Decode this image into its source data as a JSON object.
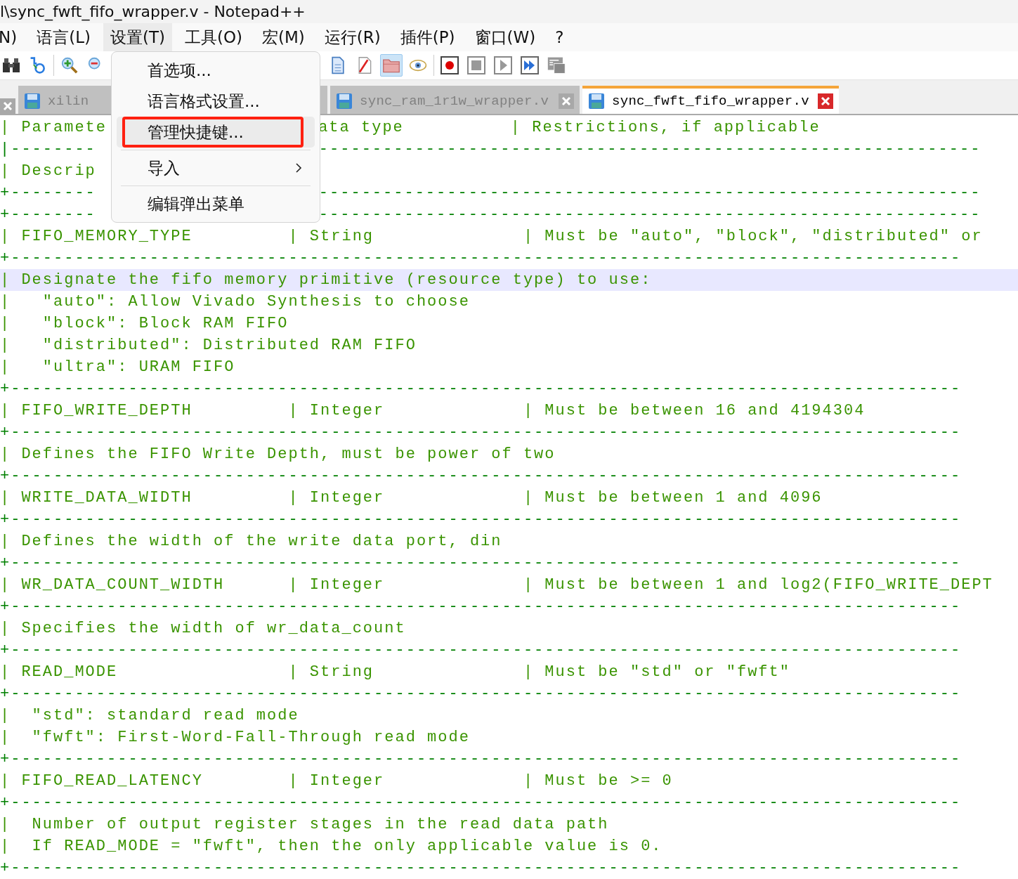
{
  "window": {
    "title": "l\\sync_fwft_fifo_wrapper.v - Notepad++"
  },
  "menu_bar": [
    {
      "label": "N)",
      "selected": false
    },
    {
      "label": "语言(L)",
      "selected": false
    },
    {
      "label": "设置(T)",
      "selected": true
    },
    {
      "label": "工具(O)",
      "selected": false
    },
    {
      "label": "宏(M)",
      "selected": false
    },
    {
      "label": "运行(R)",
      "selected": false
    },
    {
      "label": "插件(P)",
      "selected": false
    },
    {
      "label": "窗口(W)",
      "selected": false
    },
    {
      "label": "?",
      "selected": false
    }
  ],
  "toolbar": [
    {
      "pressed": false
    },
    {
      "pressed": false
    },
    {
      "pressed": false
    },
    {
      "pressed": false
    },
    {
      "pressed": false
    },
    {
      "pressed": false
    },
    {
      "pressed": true
    },
    {
      "pressed": false
    },
    {
      "pressed": false
    },
    {
      "pressed": false
    },
    {
      "pressed": false
    },
    {
      "pressed": false
    },
    {
      "pressed": false
    }
  ],
  "tabs": [
    {
      "label": "xilin",
      "selected": false
    },
    {
      "label": "sync_ram_1r1w_wrapper.v",
      "selected": false
    },
    {
      "label": "sync_fwft_fifo_wrapper.v",
      "selected": true
    }
  ],
  "dropdown_menu": {
    "items": [
      {
        "kind": "item",
        "label": "首选项...",
        "highlighted": false,
        "annotated": false
      },
      {
        "kind": "item",
        "label": "语言格式设置...",
        "highlighted": false,
        "annotated": false
      },
      {
        "kind": "item",
        "label": "管理快捷键...",
        "highlighted": true,
        "annotated": true
      },
      {
        "kind": "separator"
      },
      {
        "kind": "submenu",
        "label": "导入",
        "highlighted": false,
        "annotated": false
      },
      {
        "kind": "separator"
      },
      {
        "kind": "item",
        "label": "编辑弹出菜单",
        "highlighted": false,
        "annotated": false
      }
    ]
  },
  "editor": {
    "lines": [
      {
        "text": "| Paramete",
        "after_menu": "ata type          | Restrictions, if applicable",
        "current": false
      },
      {
        "text": "|--------",
        "after_menu": "--------------------------------------------------------------",
        "current": false
      },
      {
        "text": "| Descrip",
        "current": false
      },
      {
        "text": "+--------",
        "after_menu": "--------------------------------------------------------------",
        "current": false
      },
      {
        "text": "+--------",
        "after_menu": "--------------------------------------------------------------",
        "current": false
      },
      {
        "text": "| FIFO_MEMORY_TYPE         | String              | Must be \"auto\", \"block\", \"distributed\" or",
        "current": false
      },
      {
        "text": "+-----------------------------------------------------------------------------------------",
        "current": false
      },
      {
        "text": "| Designate the fifo memory primitive (resource type) to use:",
        "current": true
      },
      {
        "text": "|   \"auto\": Allow Vivado Synthesis to choose",
        "current": false
      },
      {
        "text": "|   \"block\": Block RAM FIFO",
        "current": false
      },
      {
        "text": "|   \"distributed\": Distributed RAM FIFO",
        "current": false
      },
      {
        "text": "|   \"ultra\": URAM FIFO",
        "current": false
      },
      {
        "text": "+-----------------------------------------------------------------------------------------",
        "current": false
      },
      {
        "text": "| FIFO_WRITE_DEPTH         | Integer             | Must be between 16 and 4194304",
        "current": false
      },
      {
        "text": "+-----------------------------------------------------------------------------------------",
        "current": false
      },
      {
        "text": "| Defines the FIFO Write Depth, must be power of two",
        "current": false
      },
      {
        "text": "+-----------------------------------------------------------------------------------------",
        "current": false
      },
      {
        "text": "| WRITE_DATA_WIDTH         | Integer             | Must be between 1 and 4096",
        "current": false
      },
      {
        "text": "+-----------------------------------------------------------------------------------------",
        "current": false
      },
      {
        "text": "| Defines the width of the write data port, din",
        "current": false
      },
      {
        "text": "+-----------------------------------------------------------------------------------------",
        "current": false
      },
      {
        "text": "| WR_DATA_COUNT_WIDTH      | Integer             | Must be between 1 and log2(FIFO_WRITE_DEPT",
        "current": false
      },
      {
        "text": "+-----------------------------------------------------------------------------------------",
        "current": false
      },
      {
        "text": "| Specifies the width of wr_data_count",
        "current": false
      },
      {
        "text": "+-----------------------------------------------------------------------------------------",
        "current": false
      },
      {
        "text": "| READ_MODE                | String              | Must be \"std\" or \"fwft\"",
        "current": false
      },
      {
        "text": "+-----------------------------------------------------------------------------------------",
        "current": false
      },
      {
        "text": "|  \"std\": standard read mode",
        "current": false
      },
      {
        "text": "|  \"fwft\": First-Word-Fall-Through read mode",
        "current": false
      },
      {
        "text": "+-----------------------------------------------------------------------------------------",
        "current": false
      },
      {
        "text": "| FIFO_READ_LATENCY        | Integer             | Must be >= 0",
        "current": false
      },
      {
        "text": "+-----------------------------------------------------------------------------------------",
        "current": false
      },
      {
        "text": "|  Number of output register stages in the read data path",
        "current": false
      },
      {
        "text": "|  If READ_MODE = \"fwft\", then the only applicable value is 0.",
        "current": false
      },
      {
        "text": "+-----------------------------------------------------------------------------------------",
        "current": false
      }
    ]
  }
}
